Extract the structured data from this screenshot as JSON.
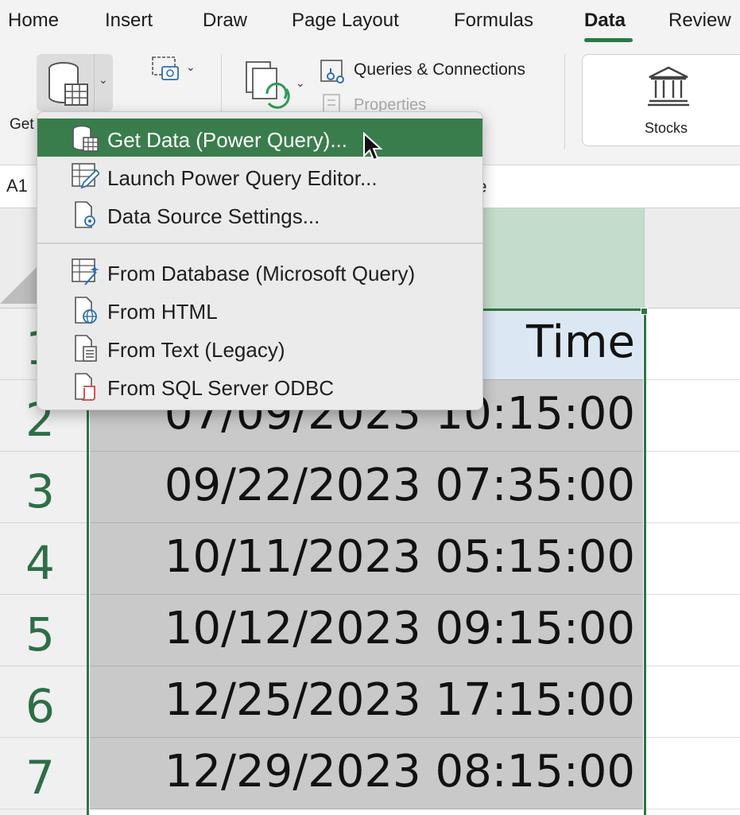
{
  "tabs": [
    {
      "label": "Home",
      "active": false
    },
    {
      "label": "Insert",
      "active": false
    },
    {
      "label": "Draw",
      "active": false
    },
    {
      "label": "Page Layout",
      "active": false
    },
    {
      "label": "Formulas",
      "active": false
    },
    {
      "label": "Data",
      "active": true
    },
    {
      "label": "Review",
      "active": false
    }
  ],
  "ribbon": {
    "get_data_label": "Get",
    "queries_connections": "Queries & Connections",
    "properties": "Properties",
    "stocks": "Stocks"
  },
  "formula_bar": {
    "cell_ref": "A1",
    "content_visible": "ne"
  },
  "menu": {
    "items": [
      {
        "label": "Get Data (Power Query)...",
        "icon": "database-table-icon",
        "highlighted": true
      },
      {
        "label": "Launch Power Query Editor...",
        "icon": "table-pencil-icon",
        "highlighted": false
      },
      {
        "label": "Data Source Settings...",
        "icon": "document-gear-icon",
        "highlighted": false
      },
      {
        "label": "From Database (Microsoft Query)",
        "icon": "table-wand-icon",
        "highlighted": false
      },
      {
        "label": "From HTML",
        "icon": "document-globe-icon",
        "highlighted": false
      },
      {
        "label": "From Text (Legacy)",
        "icon": "document-text-icon",
        "highlighted": false
      },
      {
        "label": "From SQL Server ODBC",
        "icon": "document-scroll-icon",
        "highlighted": false
      }
    ]
  },
  "grid": {
    "rows": [
      {
        "num": "1",
        "value": "Time"
      },
      {
        "num": "2",
        "value": "07/09/2023 10:15:00"
      },
      {
        "num": "3",
        "value": "09/22/2023 07:35:00"
      },
      {
        "num": "4",
        "value": "10/11/2023 05:15:00"
      },
      {
        "num": "5",
        "value": "10/12/2023 09:15:00"
      },
      {
        "num": "6",
        "value": "12/25/2023 17:15:00"
      },
      {
        "num": "7",
        "value": "12/29/2023 08:15:00"
      }
    ]
  },
  "colors": {
    "accent": "#2a7a48",
    "menu_highlight": "#3a7d4c",
    "selected_cells": "#c9c9c9",
    "header_cell": "#dce7f4"
  }
}
